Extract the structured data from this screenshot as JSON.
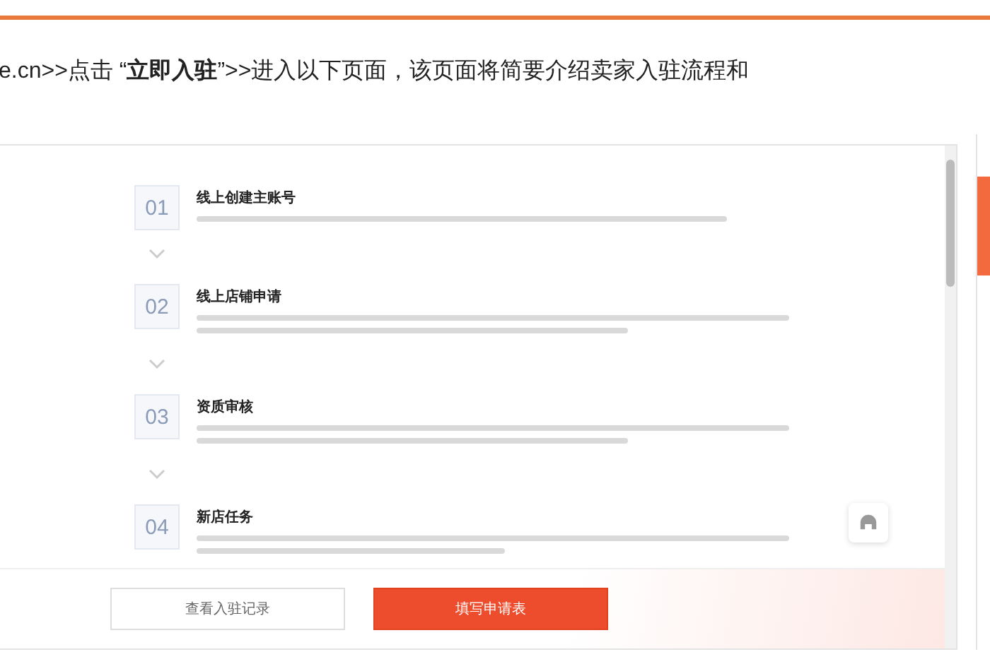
{
  "intro": "e.cn>>点击 “**立即入驻**”>>进入以下页面，该页面将简要介绍卖家入驻流程和",
  "steps": [
    {
      "number": "01",
      "title": "线上创建主账号"
    },
    {
      "number": "02",
      "title": "线上店铺申请"
    },
    {
      "number": "03",
      "title": "资质审核"
    },
    {
      "number": "04",
      "title": "新店任务"
    }
  ],
  "buttons": [
    {
      "label": "查看入驻记录",
      "kind": "outline"
    },
    {
      "label": "填写申请表",
      "kind": "primary"
    }
  ]
}
